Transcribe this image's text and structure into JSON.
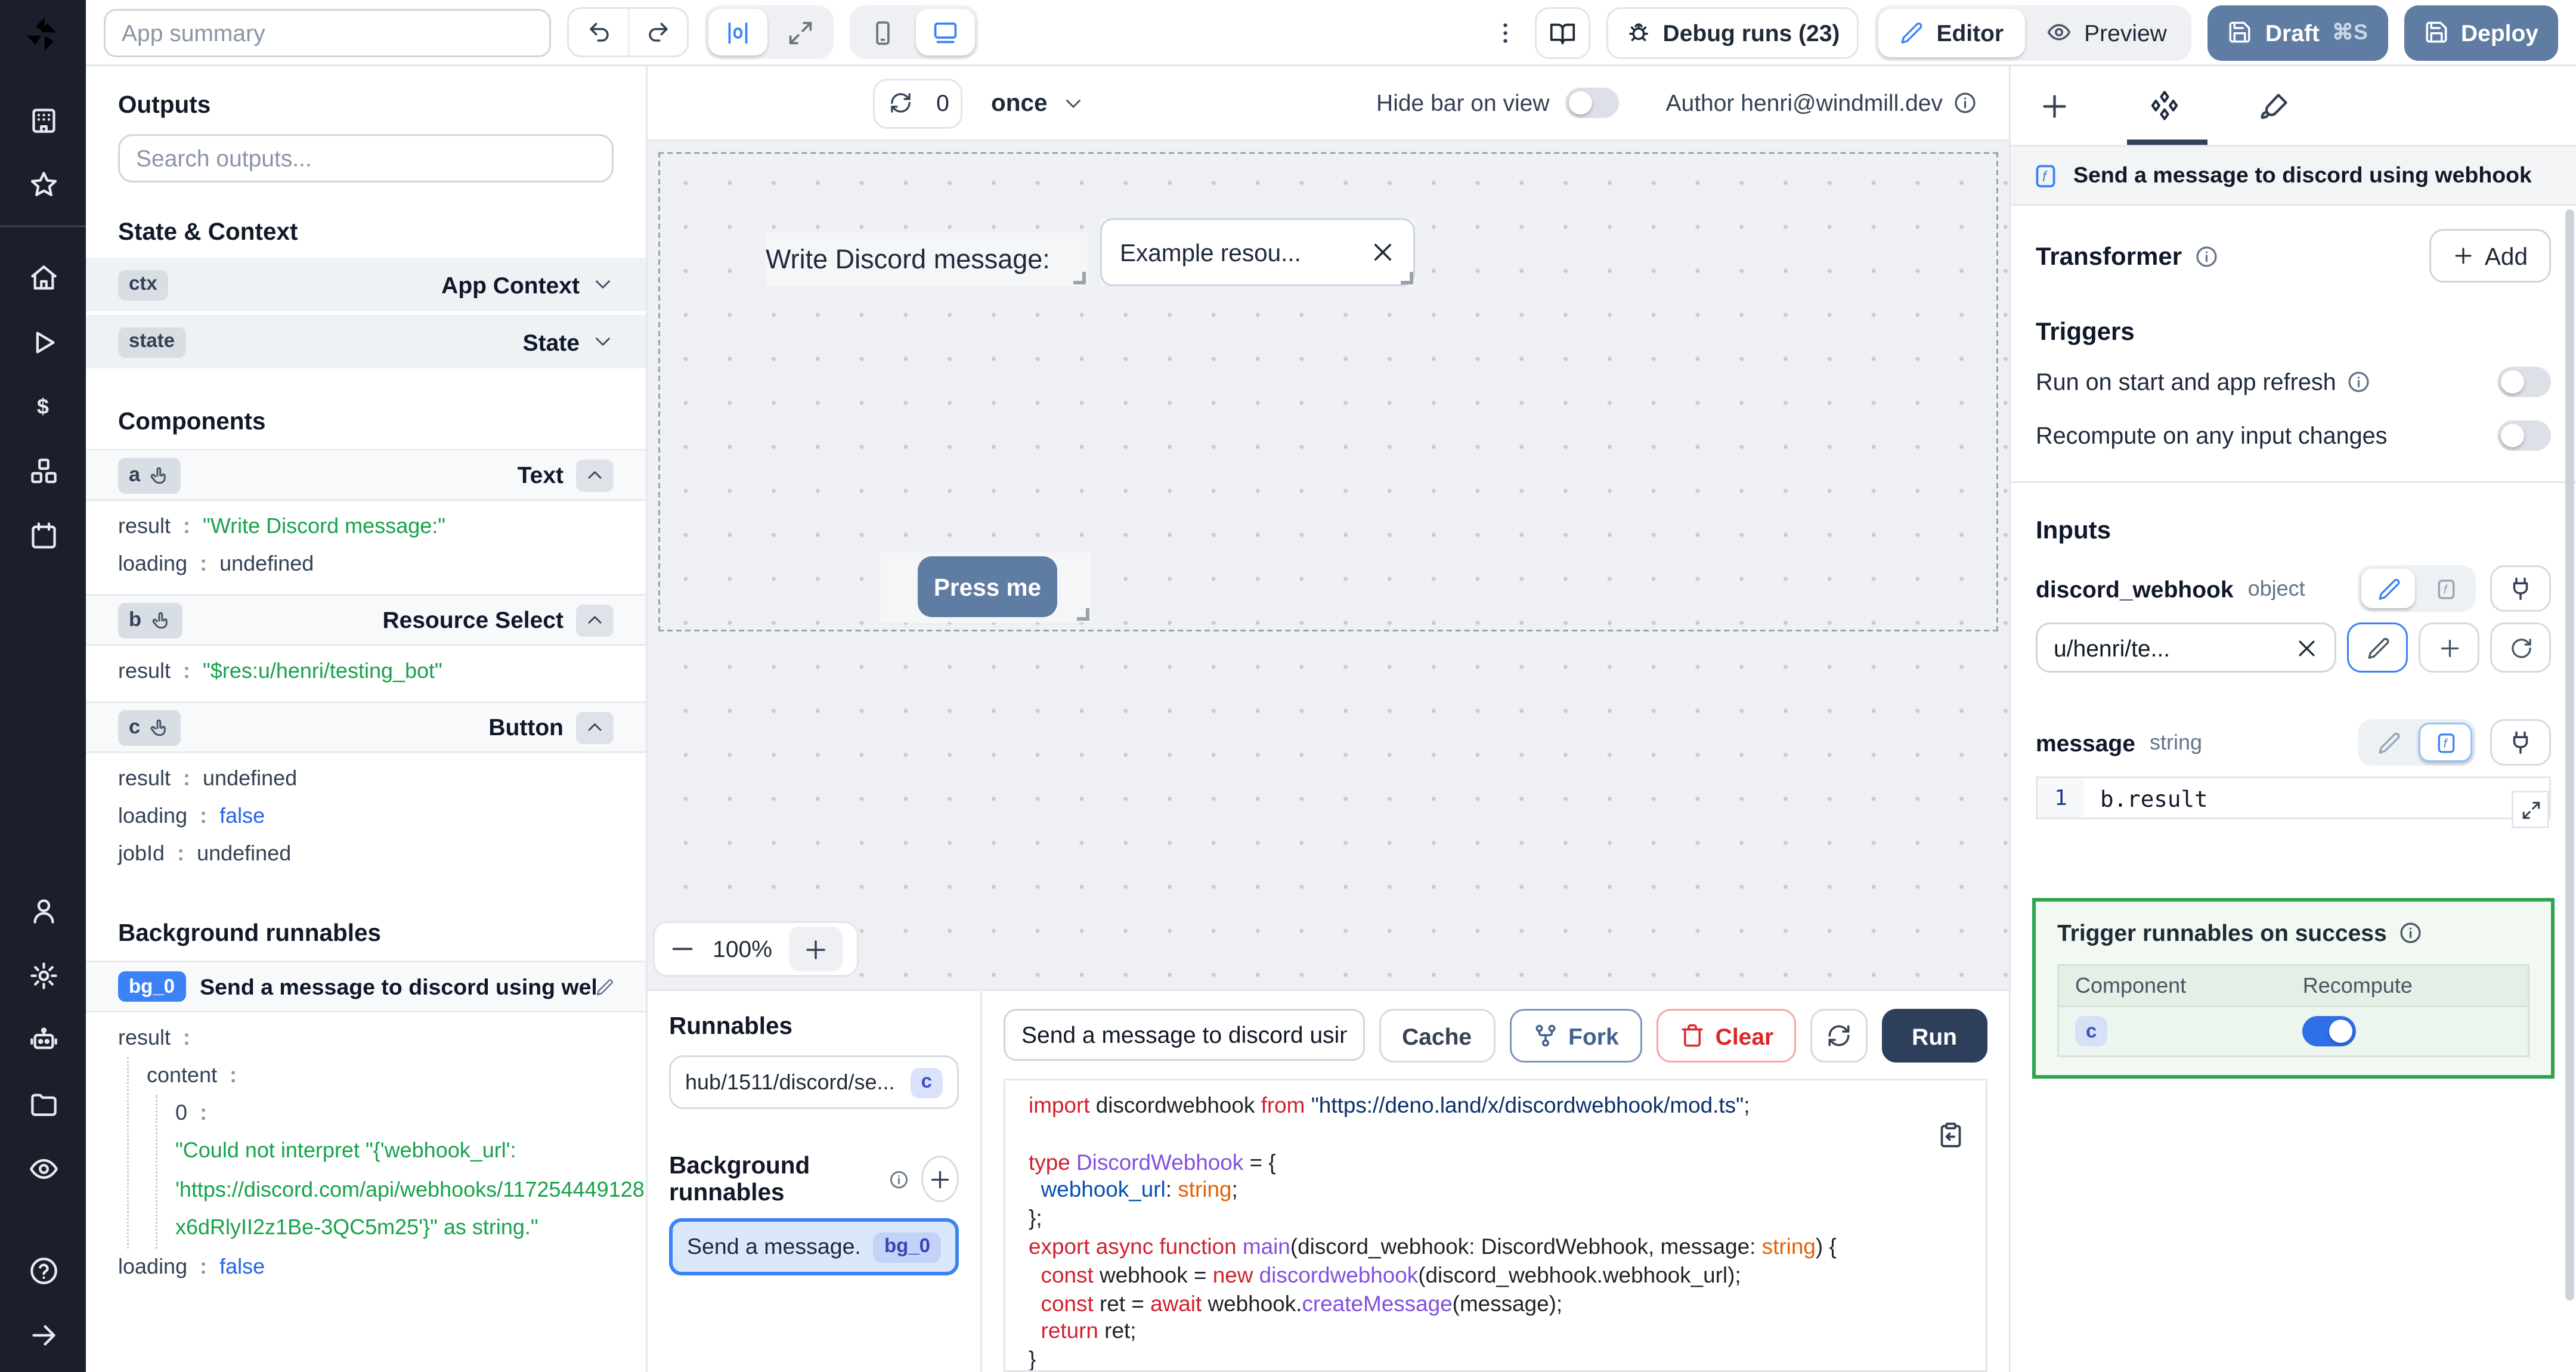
{
  "colors": {
    "accent": "#3b82f6",
    "slate_button": "#5f7ca3",
    "run_button": "#2e3f5c",
    "success_border": "#2ea44f",
    "string_green": "#16a34a",
    "bool_blue": "#2563eb",
    "sidebar_bg": "#1b1f2b"
  },
  "icons": {
    "windmill-logo": "pinwheel",
    "building": "workspace",
    "star": "favorites",
    "home": "home",
    "play": "runs",
    "dollar": "billing",
    "cubes": "resources",
    "calendar": "schedules",
    "user": "account",
    "gear": "settings",
    "robot": "workers",
    "folder": "folders",
    "eye": "audit",
    "help": "help",
    "arrow-right": "collapse",
    "undo": "undo-arrow",
    "redo": "redo-arrow",
    "align": "center-layout",
    "maximize": "fullscreen",
    "phone": "mobile-view",
    "monitor": "desktop-view",
    "kebab": "more-menu",
    "book": "docs",
    "bug": "debug",
    "pencil": "edit",
    "eye2": "preview",
    "save": "save",
    "refresh": "refresh",
    "rotate": "rerun",
    "chev-down": "chevron-down",
    "chev-up": "chevron-up",
    "close": "clear-x",
    "info": "info",
    "plus": "add",
    "minus": "zoom-out",
    "diamonds": "components",
    "brush": "styling",
    "fsquare": "function",
    "plug": "connect",
    "fork": "fork",
    "trash": "trash",
    "clip": "copy-code",
    "expand": "expand-editor",
    "hand": "component-pointer"
  },
  "sidebar": {
    "groups": [
      [
        "building",
        "star"
      ],
      [
        "home",
        "play",
        "dollar",
        "cubes",
        "calendar"
      ],
      [
        "user",
        "gear",
        "robot",
        "folder",
        "eye"
      ],
      [
        "help",
        "arrow-right"
      ]
    ]
  },
  "header": {
    "app_summary_placeholder": "App summary",
    "debug_runs_label": "Debug runs (23)",
    "editor_label": "Editor",
    "preview_label": "Preview",
    "draft_label": "Draft",
    "draft_shortcut": "⌘S",
    "deploy_label": "Deploy"
  },
  "canvas_bar": {
    "refresh_count": "0",
    "schedule": "once",
    "hide_bar_label": "Hide bar on view",
    "author_label": "Author henri@windmill.dev"
  },
  "canvas": {
    "text_component": "Write Discord message:",
    "select_value": "Example resou...",
    "button_label": "Press me",
    "zoom_level": "100%"
  },
  "outputs": {
    "title": "Outputs",
    "search_placeholder": "Search outputs...",
    "state_context": {
      "title": "State & Context",
      "rows": [
        {
          "badge": "ctx",
          "label": "App Context"
        },
        {
          "badge": "state",
          "label": "State"
        }
      ]
    },
    "components": {
      "title": "Components",
      "items": [
        {
          "badge": "a",
          "type": "Text",
          "fields": [
            {
              "key": "result",
              "value": "\"Write Discord message:\"",
              "kind": "string"
            },
            {
              "key": "loading",
              "value": "undefined",
              "kind": "plain"
            }
          ]
        },
        {
          "badge": "b",
          "type": "Resource Select",
          "fields": [
            {
              "key": "result",
              "value": "\"$res:u/henri/testing_bot\"",
              "kind": "string"
            }
          ]
        },
        {
          "badge": "c",
          "type": "Button",
          "fields": [
            {
              "key": "result",
              "value": "undefined",
              "kind": "plain"
            },
            {
              "key": "loading",
              "value": "false",
              "kind": "bool"
            },
            {
              "key": "jobId",
              "value": "undefined",
              "kind": "plain"
            }
          ]
        }
      ]
    },
    "background_runnables": {
      "title": "Background runnables",
      "badge": "bg_0",
      "name": "Send a message to discord using webhook",
      "result_key": "result",
      "content_key": "content",
      "index_key": "0",
      "string_lines": [
        "\"Could not interpret \"{'webhook_url':",
        "'https://discord.com/api/webhooks/117254449128",
        "x6dRlyII2z1Be-3QC5m25'}\" as string.\""
      ],
      "loading_key": "loading",
      "loading_value": "false"
    }
  },
  "runnables": {
    "title": "Runnables",
    "script_item": {
      "name": "hub/1511/discord/se...",
      "badge": "c"
    },
    "background_title": "Background runnables",
    "background_item": {
      "name": "Send a message...",
      "badge": "bg_0"
    }
  },
  "editor": {
    "name_value": "Send a message to discord using",
    "cache_label": "Cache",
    "fork_label": "Fork",
    "clear_label": "Clear",
    "run_label": "Run",
    "code": [
      [
        [
          "kw",
          "import"
        ],
        [
          "pl",
          " discordwebhook "
        ],
        [
          "kw",
          "from"
        ],
        [
          "str",
          " \"https://deno.land/x/discordwebhook/mod.ts\""
        ],
        [
          "pl",
          ";"
        ]
      ],
      [],
      [
        [
          "kw",
          "type"
        ],
        [
          "ty",
          " DiscordWebhook"
        ],
        [
          "pl",
          " = {"
        ]
      ],
      [
        [
          "pl",
          "  "
        ],
        [
          "pr",
          "webhook_url"
        ],
        [
          "pl",
          ": "
        ],
        [
          "or",
          "string"
        ],
        [
          "pl",
          ";"
        ]
      ],
      [
        [
          "pl",
          "};"
        ]
      ],
      [
        [
          "kw",
          "export async function"
        ],
        [
          "ty",
          " main"
        ],
        [
          "pl",
          "(discord_webhook: DiscordWebhook, message: "
        ],
        [
          "or",
          "string"
        ],
        [
          "pl",
          ") {"
        ]
      ],
      [
        [
          "pl",
          "  "
        ],
        [
          "kw",
          "const"
        ],
        [
          "pl",
          " webhook = "
        ],
        [
          "kw",
          "new"
        ],
        [
          "ty",
          " discordwebhook"
        ],
        [
          "pl",
          "(discord_webhook.webhook_url);"
        ]
      ],
      [
        [
          "pl",
          "  "
        ],
        [
          "kw",
          "const"
        ],
        [
          "pl",
          " ret = "
        ],
        [
          "kw",
          "await"
        ],
        [
          "pl",
          " webhook."
        ],
        [
          "ty",
          "createMessage"
        ],
        [
          "pl",
          "(message);"
        ]
      ],
      [
        [
          "pl",
          "  "
        ],
        [
          "kw",
          "return"
        ],
        [
          "pl",
          " ret;"
        ]
      ],
      [
        [
          "pl",
          "}"
        ]
      ]
    ]
  },
  "inspector": {
    "title": "Send a message to discord using webhook",
    "transformer_label": "Transformer",
    "add_label": "Add",
    "triggers_title": "Triggers",
    "triggers": [
      {
        "label": "Run on start and app refresh",
        "info": true,
        "on": false
      },
      {
        "label": "Recompute on any input changes",
        "info": false,
        "on": false
      }
    ],
    "inputs_title": "Inputs",
    "input1": {
      "name": "discord_webhook",
      "type": "object",
      "value": "u/henri/te..."
    },
    "input2": {
      "name": "message",
      "type": "string",
      "line": "1",
      "expr": "b.result"
    },
    "success": {
      "title": "Trigger runnables on success",
      "col1": "Component",
      "col2": "Recompute",
      "rows": [
        {
          "component": "c",
          "on": true
        }
      ]
    }
  }
}
